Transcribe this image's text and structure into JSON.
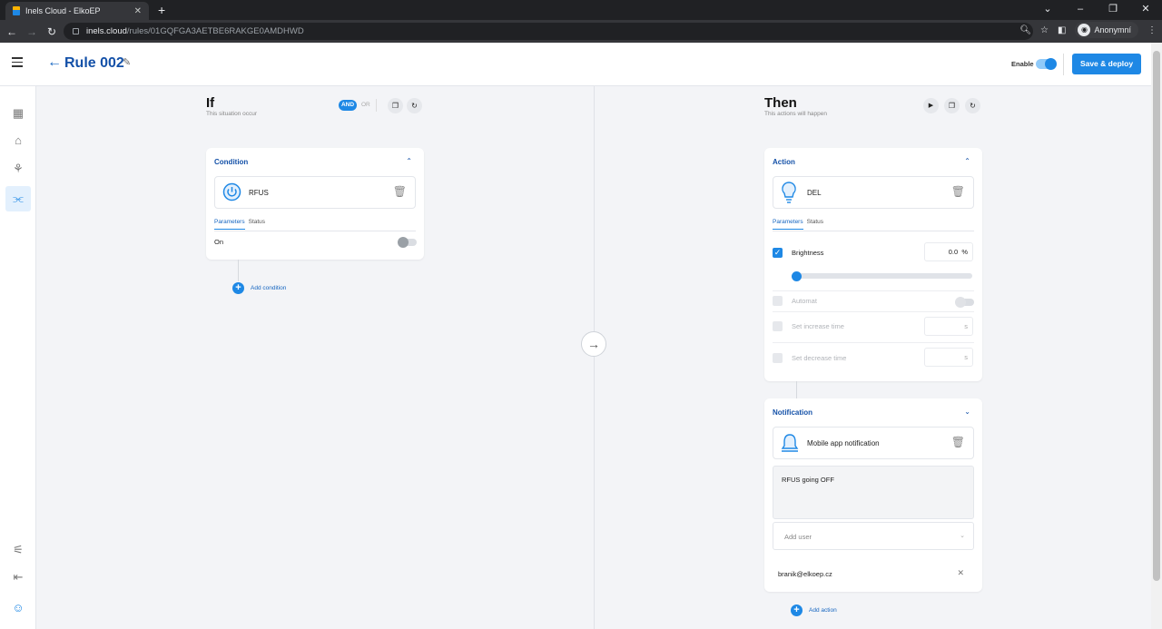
{
  "browser": {
    "tab_title": "Inels Cloud - ElkoEP",
    "url_host": "inels.cloud",
    "url_path": "/rules/01GQFGA3AETBE6RAKGE0AMDHWD",
    "profile_label": "Anonymní"
  },
  "header": {
    "rule_title": "Rule 002",
    "enable_label": "Enable",
    "enabled": true,
    "deploy_label": "Save & deploy"
  },
  "sidebar": {
    "icons": [
      "dashboard-icon",
      "sofa-icon",
      "devices-icon",
      "rules-icon",
      "settings-icon",
      "logout-icon",
      "user-icon"
    ],
    "active": "rules-icon"
  },
  "if_column": {
    "title": "If",
    "subtitle": "This situation occur",
    "and_label": "AND",
    "or_label": "OR",
    "condition": {
      "title": "Condition",
      "device_name": "RFUS",
      "tabs": [
        "Parameters",
        "Status"
      ],
      "param_label": "On",
      "param_value": false
    },
    "add_condition_label": "Add condition"
  },
  "then_column": {
    "title": "Then",
    "subtitle": "This actions will happen",
    "action": {
      "title": "Action",
      "device_name": "DEL",
      "tabs": [
        "Parameters",
        "Status"
      ],
      "brightness_label": "Brightness",
      "brightness_value": "0.0",
      "brightness_unit": "%",
      "brightness_slider_fraction": 0.0,
      "automat_label": "Automat",
      "increase_label": "Set increase time",
      "increase_unit": "s",
      "decrease_label": "Set decrease time",
      "decrease_unit": "s"
    },
    "notification": {
      "title": "Notification",
      "type_label": "Mobile app notification",
      "message": "RFUS going OFF",
      "add_user_placeholder": "Add user",
      "users": [
        "branik@elkoep.cz"
      ]
    },
    "add_action_label": "Add action"
  },
  "colors": {
    "accent": "#1e88e5",
    "title_blue": "#1451a8"
  }
}
